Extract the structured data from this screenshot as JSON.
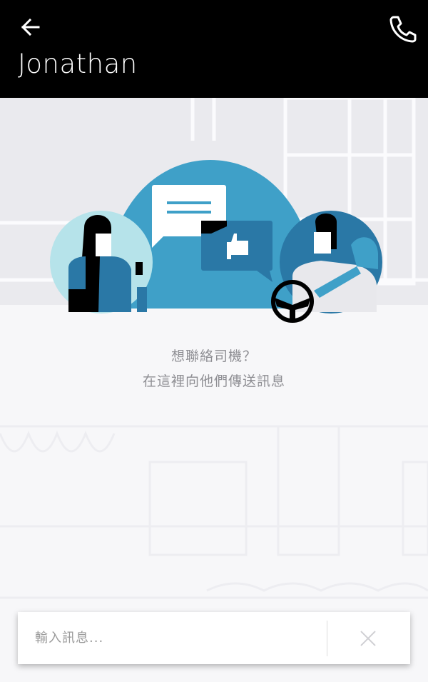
{
  "header": {
    "title": "Jonathan",
    "back_icon": "arrow-left-icon",
    "call_icon": "phone-icon"
  },
  "empty_state": {
    "line1": "想聯絡司機？",
    "line2": "在這裡向他們傳送訊息"
  },
  "composer": {
    "placeholder": "輸入訊息...",
    "send_icon": "close-icon"
  },
  "colors": {
    "header_bg": "#000000",
    "accent_blue": "#3fa0c8",
    "dark_blue": "#2a78a6",
    "light_teal": "#b6e3ea"
  }
}
